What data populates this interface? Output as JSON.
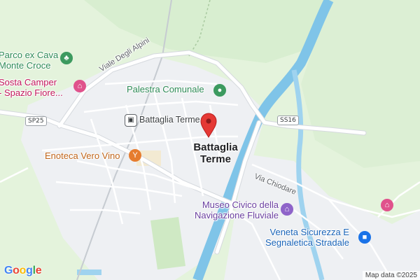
{
  "map": {
    "town": {
      "line1": "Battaglia",
      "line2": "Terme"
    },
    "pois": {
      "parco": {
        "line1": "Parco ex Cava",
        "line2": "Monte Croce"
      },
      "sosta": {
        "line1": "Sosta Camper",
        "line2": "- Spazio Fiore..."
      },
      "palestra": "Palestra Comunale",
      "station": "Battaglia Terme",
      "enoteca": "Enoteca Vero Vino",
      "museo": {
        "line1": "Museo Civico della",
        "line2": "Navigazione Fluviale"
      },
      "veneta": {
        "line1": "Veneta Sicurezza E",
        "line2": "Segnaletica Stradale"
      }
    },
    "streets": {
      "viale_alpini": "Viale Degli Alpini",
      "via_chiodare": "Via Chiodare"
    },
    "shields": {
      "sp25": "SP25",
      "ss16": "SS16"
    },
    "icons": {
      "park": "tree-icon",
      "hotel": "bed-icon",
      "gym": "gym-icon",
      "train": "train-icon",
      "wine": "wine-glass-icon",
      "museum": "museum-icon",
      "shop": "shopping-bag-icon",
      "pin": "location-pin-icon"
    },
    "colors": {
      "land": "#e8f5e2",
      "urban": "#eef0f3",
      "water": "#7fc4e8",
      "road": "#ffffff",
      "pin": "#e53935"
    },
    "attribution": "Map data ©2025",
    "logo": "Google"
  }
}
